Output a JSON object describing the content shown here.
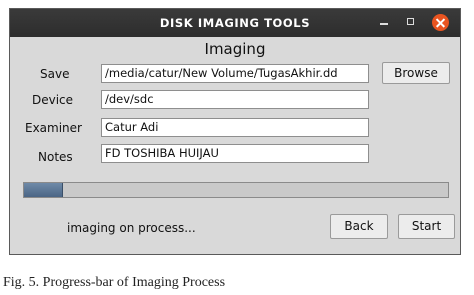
{
  "window": {
    "title": "DISK IMAGING TOOLS",
    "heading": "Imaging",
    "form": {
      "save_label": "Save",
      "save_value": "/media/catur/New Volume/TugasAkhir.dd",
      "browse_label": "Browse",
      "device_label": "Device",
      "device_value": "/dev/sdc",
      "examiner_label": "Examiner",
      "examiner_value": "Catur Adi",
      "notes_label": "Notes",
      "notes_value": "FD TOSHIBA HUIJAU"
    },
    "progress": {
      "fraction": 0.09
    },
    "status": "imaging on process...",
    "buttons": {
      "back": "Back",
      "start": "Start"
    },
    "controls": {
      "minimize": "minimize-icon",
      "maximize": "maximize-icon",
      "close": "close-icon"
    }
  },
  "caption": "Fig. 5. Progress-bar of Imaging Process",
  "colors": {
    "titlebar": "#2d2d2d",
    "close": "#e95420",
    "window_bg": "#d9d9d9",
    "progress_fill": "#4a6585"
  }
}
